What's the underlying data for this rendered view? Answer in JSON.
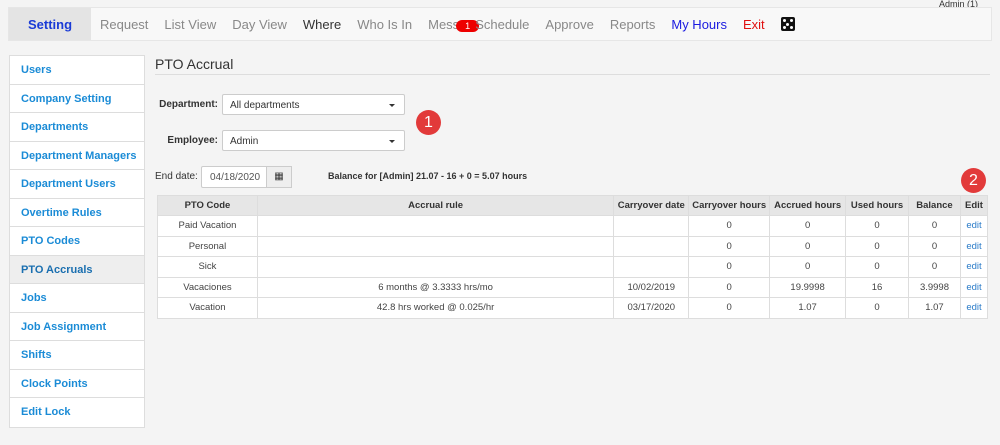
{
  "user_label": "Admin (1)",
  "nav": {
    "setting": "Setting",
    "items": [
      "Request",
      "List View",
      "Day View",
      "Where",
      "Who Is In",
      "Mess",
      "Schedule",
      "Approve",
      "Reports",
      "My Hours",
      "Exit"
    ],
    "message_count": "1"
  },
  "sidebar": {
    "items": [
      "Users",
      "Company Setting",
      "Departments",
      "Department Managers",
      "Department Users",
      "Overtime Rules",
      "PTO Codes",
      "PTO Accruals",
      "Jobs",
      "Job Assignment",
      "Shifts",
      "Clock Points",
      "Edit Lock"
    ],
    "active": "PTO Accruals"
  },
  "page": {
    "title": "PTO Accrual",
    "department_label": "Department:",
    "department_value": "All departments",
    "employee_label": "Employee:",
    "employee_value": "Admin",
    "end_date_label": "End date:",
    "end_date_value": "04/18/2020",
    "balance_text": "Balance for [Admin] 21.07 - 16 + 0 = 5.07 hours",
    "callout_1": "1",
    "callout_2": "2"
  },
  "table": {
    "headers": [
      "PTO Code",
      "Accrual rule",
      "Carryover date",
      "Carryover hours",
      "Accrued hours",
      "Used hours",
      "Balance",
      "Edit"
    ],
    "rows": [
      [
        "Paid Vacation",
        "",
        "",
        "0",
        "0",
        "0",
        "0",
        "edit"
      ],
      [
        "Personal",
        "",
        "",
        "0",
        "0",
        "0",
        "0",
        "edit"
      ],
      [
        "Sick",
        "",
        "",
        "0",
        "0",
        "0",
        "0",
        "edit"
      ],
      [
        "Vacaciones",
        "6 months @ 3.3333 hrs/mo",
        "10/02/2019",
        "0",
        "19.9998",
        "16",
        "3.9998",
        "edit"
      ],
      [
        "Vacation",
        "42.8 hrs worked @ 0.025/hr",
        "03/17/2020",
        "0",
        "1.07",
        "0",
        "1.07",
        "edit"
      ]
    ]
  }
}
